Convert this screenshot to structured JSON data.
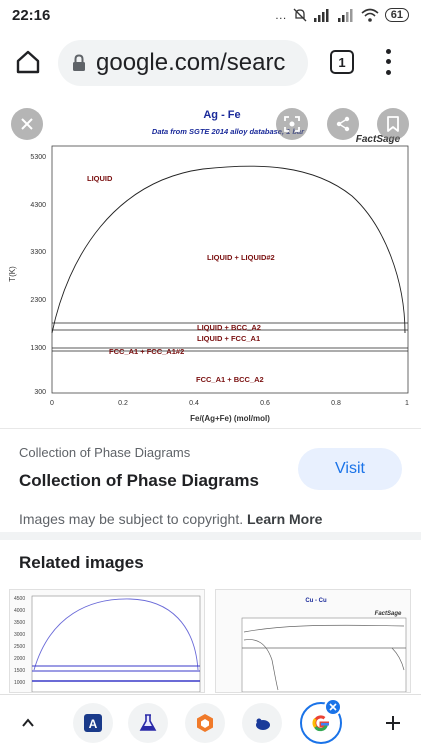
{
  "status_bar": {
    "time": "22:16",
    "icons_text": "…",
    "battery": "61"
  },
  "browser": {
    "url": "google.com/searc",
    "tab_count": "1"
  },
  "preview_image": {
    "title": "Ag - Fe",
    "subtitle": "Data from SGTE 2014 alloy database, 1 bar",
    "brand": "FactSage",
    "xlabel": "Fe/(Ag+Fe) (mol/mol)",
    "ylabel": "T(K)",
    "y_ticks": [
      "5300",
      "4300",
      "3300",
      "2300",
      "1300",
      "300"
    ],
    "x_ticks": [
      "0",
      "0.2",
      "0.4",
      "0.6",
      "0.8",
      "1"
    ],
    "regions": [
      "LIQUID",
      "LIQUID + LIQUID#2",
      "LIQUID + BCC_A2",
      "LIQUID + FCC_A1",
      "FCC_A1 + FCC_A1#2",
      "FCC_A1 + BCC_A2"
    ]
  },
  "info": {
    "source": "Collection of Phase Diagrams",
    "title": "Collection of Phase Diagrams",
    "visit_label": "Visit",
    "copyright_text": "Images may be subject to copyright.",
    "learn_more": "Learn More"
  },
  "related": {
    "heading": "Related images",
    "thumb2_title": "Cu - Cu",
    "thumb2_brand": "FactSage"
  },
  "colors": {
    "accent": "#1a73e8",
    "region_label": "#7a1010",
    "chart_title": "#1a2a9a"
  }
}
